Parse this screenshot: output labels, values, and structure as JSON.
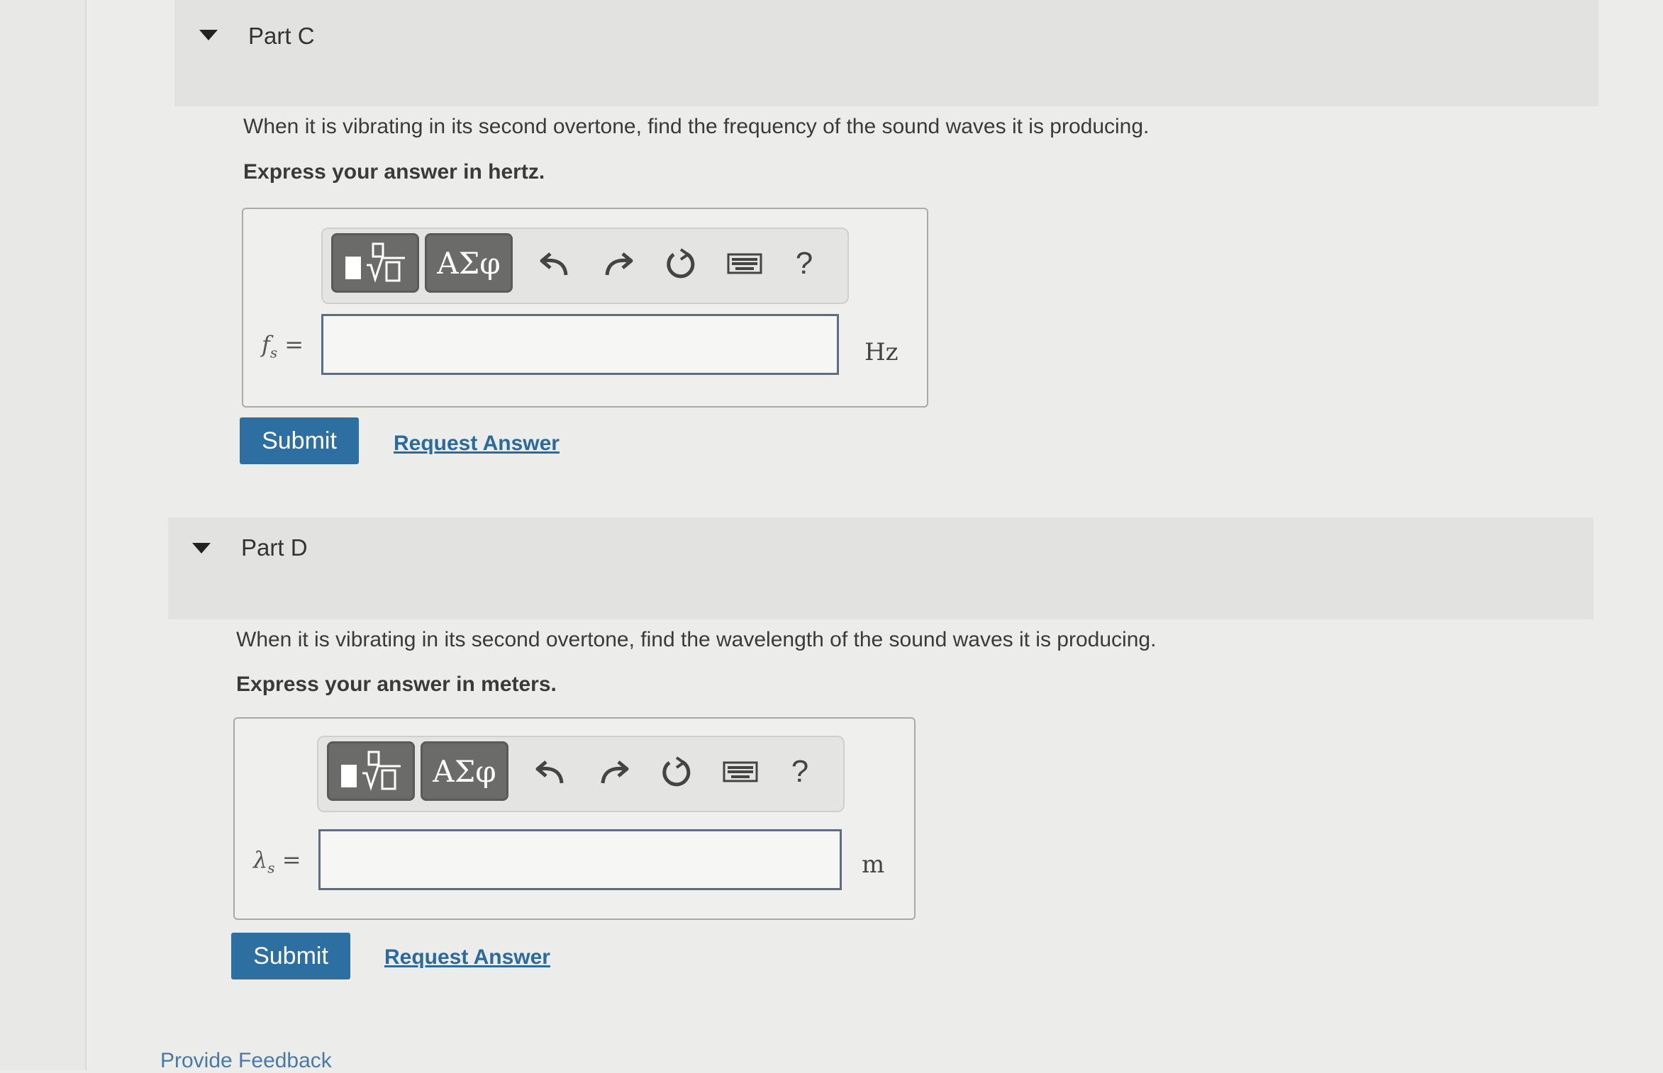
{
  "parts": [
    {
      "title": "Part C",
      "question": "When it is vibrating in its second overtone, find the frequency of the sound waves it is producing.",
      "instruction": "Express your answer in hertz.",
      "variable_base": "f",
      "variable_sub": "s",
      "equals": "=",
      "input_value": "",
      "unit": "Hz",
      "submit_label": "Submit",
      "request_label": "Request Answer"
    },
    {
      "title": "Part D",
      "question": "When it is vibrating in its second overtone, find the wavelength of the sound waves it is producing.",
      "instruction": "Express your answer in meters.",
      "variable_base": "λ",
      "variable_sub": "s",
      "equals": "=",
      "input_value": "",
      "unit": "m",
      "submit_label": "Submit",
      "request_label": "Request Answer"
    }
  ],
  "toolbar": {
    "greek_label": "ΑΣφ",
    "help_label": "?"
  },
  "footer": {
    "feedback_label": "Provide Feedback"
  },
  "icons": [
    "caret-down-icon",
    "template-icon",
    "undo-icon",
    "redo-icon",
    "reset-icon",
    "keyboard-icon",
    "help-icon"
  ],
  "colors": {
    "submit_bg": "#2d6fa0",
    "link": "#2b6b9c",
    "toolbar_button": "#6b6b69"
  }
}
